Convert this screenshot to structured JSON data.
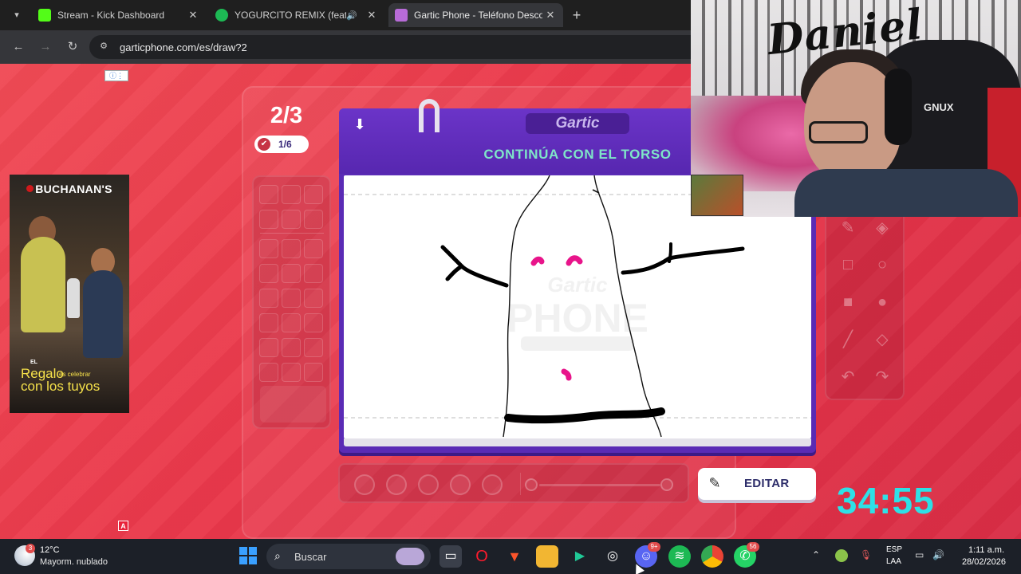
{
  "browser": {
    "tabs": [
      {
        "title": "Stream - Kick Dashboard",
        "favicon_color": "#53fc18",
        "active": false
      },
      {
        "title": "YOGURCITO REMIX (feat. Kr",
        "favicon_color": "#1db954",
        "active": false,
        "audio": true
      },
      {
        "title": "Gartic Phone - Teléfono Descon",
        "favicon_color": "#b86bd8",
        "active": true
      }
    ],
    "new_tab_label": "+",
    "url": "garticphone.com/es/draw?2"
  },
  "ad": {
    "brand": "BUCHANAN'S",
    "tagline_el": "EL",
    "tagline_1": "Regalo",
    "tagline_small": "es celebrar",
    "tagline_2": "con los tuyos"
  },
  "game": {
    "round": "2/3",
    "players_done": "1/6",
    "logo_text": "Gartic",
    "prompt": "CONTINÚA CON EL TORSO",
    "watermark_line1": "Gartic",
    "watermark_line2": "PHONE",
    "edit_label": "EDITAR",
    "timer": "34:55",
    "warn_label": "A",
    "adchoice_label": "ⓘ⋮"
  },
  "webcam": {
    "graffiti_tag": "Daniel",
    "chair_brand": "GNUX"
  },
  "taskbar": {
    "weather_badge": "3",
    "temperature": "12°C",
    "condition": "Mayorm. nublado",
    "search_label": "Buscar",
    "discord_badge": "9+",
    "whatsapp_badge": "56",
    "lang_line1": "ESP",
    "lang_line2": "LAA",
    "time": "1:11 a.m.",
    "date": "28/02/2026"
  },
  "colors": {
    "page_red": "#e9374a",
    "card_purple": "#5a2bb5",
    "prompt_teal": "#7fe5c8",
    "timer_cyan": "#2ee0e6",
    "ink_pink": "#e8148a"
  },
  "icons": {
    "download": "download-icon",
    "edit": "pencil-icon",
    "back": "arrow-left-icon",
    "forward": "arrow-right-icon",
    "reload": "reload-icon"
  }
}
